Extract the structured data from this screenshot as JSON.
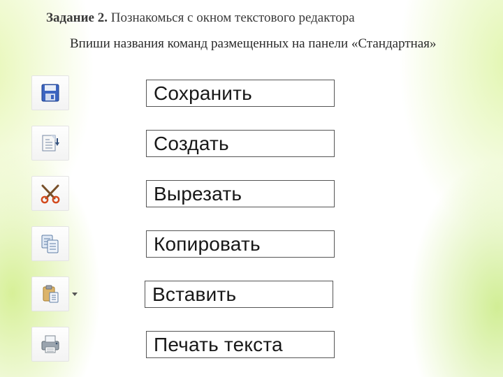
{
  "heading": {
    "task_label": "Задание 2.",
    "task_text": "Познакомься с окном текстового редактора"
  },
  "subheading": "Впиши названия команд размещенных на панели «Стандартная»",
  "rows": [
    {
      "icon": "save",
      "label": "Сохранить"
    },
    {
      "icon": "new",
      "label": "Создать"
    },
    {
      "icon": "cut",
      "label": "Вырезать"
    },
    {
      "icon": "copy",
      "label": "Копировать"
    },
    {
      "icon": "paste",
      "label": "Вставить"
    },
    {
      "icon": "print",
      "label": "Печать текста"
    }
  ]
}
